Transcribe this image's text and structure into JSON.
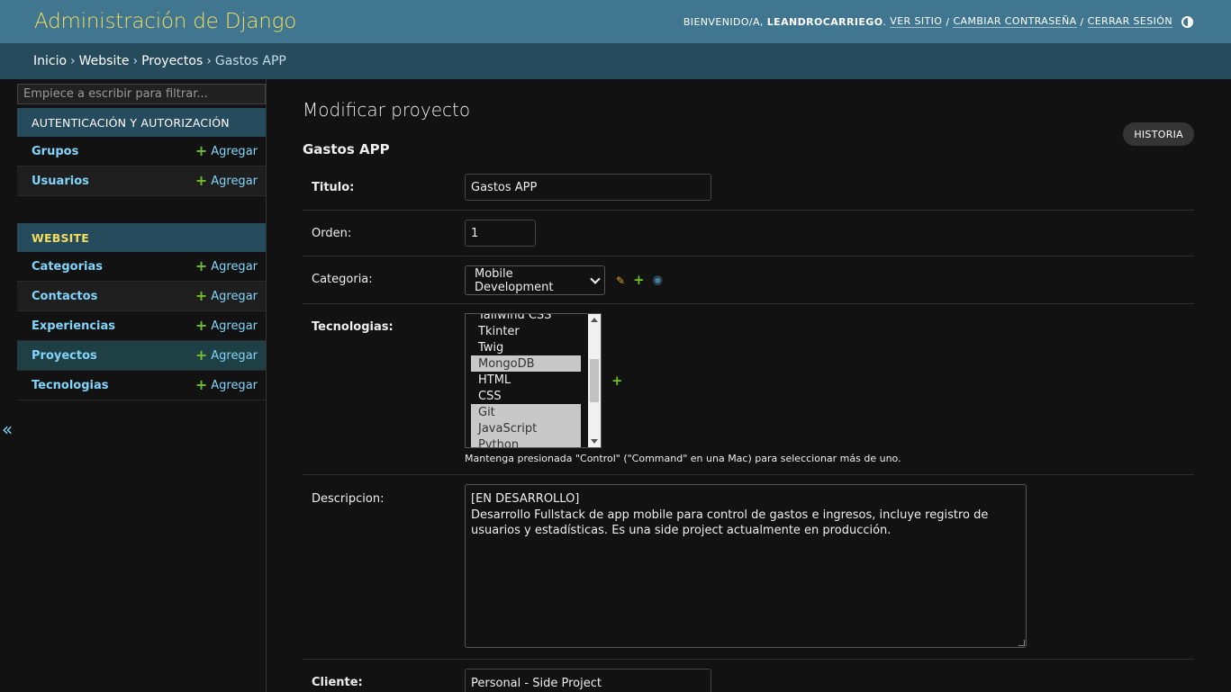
{
  "header": {
    "brand": "Administración de Django",
    "welcome": "BIENVENIDO/A,",
    "username": "LEANDROCARRIEGO",
    "view_site": "VER SITIO",
    "change_password": "CAMBIAR CONTRASEÑA",
    "logout": "CERRAR SESIÓN",
    "separator": "/"
  },
  "breadcrumbs": {
    "home": "Inicio",
    "app": "Website",
    "model": "Proyectos",
    "current": "Gastos APP",
    "sep": "›"
  },
  "sidebar": {
    "filter_placeholder": "Empiece a escribir para filtrar...",
    "add_label": "Agregar",
    "modules": [
      {
        "caption": "Autenticación y autorización",
        "models": [
          "Grupos",
          "Usuarios"
        ]
      },
      {
        "caption": "Website",
        "models": [
          "Categorias",
          "Contactos",
          "Experiencias",
          "Proyectos",
          "Tecnologias"
        ]
      }
    ],
    "collapse_glyph": "«"
  },
  "main": {
    "page_title": "Modificar proyecto",
    "history_button": "HISTORIA",
    "object_title": "Gastos APP"
  },
  "form": {
    "titulo": {
      "label": "Titulo:",
      "value": "Gastos APP"
    },
    "orden": {
      "label": "Orden:",
      "value": "1"
    },
    "categoria": {
      "label": "Categoria:",
      "value": "Mobile Development"
    },
    "tecnologias": {
      "label": "Tecnologias:",
      "options": [
        {
          "label": "Tailwind CSS",
          "selected": false
        },
        {
          "label": "Tkinter",
          "selected": false
        },
        {
          "label": "Twig",
          "selected": false
        },
        {
          "label": "MongoDB",
          "selected": true
        },
        {
          "label": "HTML",
          "selected": false
        },
        {
          "label": "CSS",
          "selected": false
        },
        {
          "label": "Git",
          "selected": true
        },
        {
          "label": "JavaScript",
          "selected": true
        },
        {
          "label": "Python",
          "selected": true
        }
      ],
      "help": "Mantenga presionada \"Control\" (\"Command\" en una Mac) para seleccionar más de uno."
    },
    "descripcion": {
      "label": "Descripcion:",
      "value": "[EN DESARROLLO]\nDesarrollo Fullstack de app mobile para control de gastos e ingresos, incluye registro de usuarios y estadísticas. Es una side project actualmente en producción."
    },
    "cliente": {
      "label": "Cliente:",
      "value": "Personal - Side Project"
    }
  },
  "colors": {
    "header_bg": "#417690",
    "brand": "#f5dd5d",
    "breadcrumbs_bg": "#264b5d",
    "link": "#81d4fa",
    "add_icon": "#70bf2b",
    "active_row": "#1e3f43",
    "background": "#121212"
  }
}
